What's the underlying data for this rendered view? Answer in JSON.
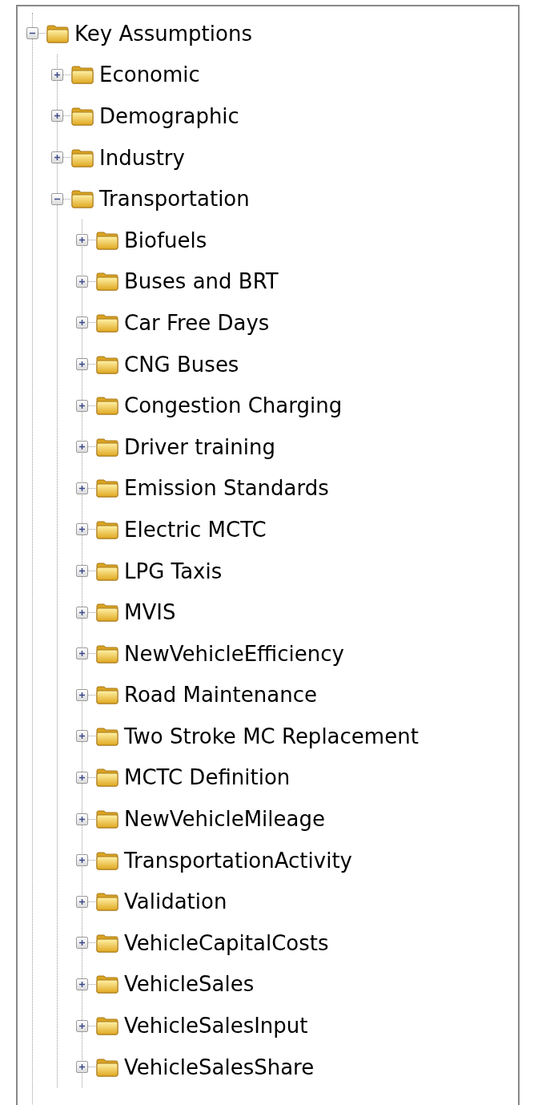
{
  "tree": [
    {
      "label": "Key Assumptions",
      "expanded": true,
      "children": [
        {
          "label": "Economic",
          "expanded": false
        },
        {
          "label": "Demographic",
          "expanded": false
        },
        {
          "label": "Industry",
          "expanded": false
        },
        {
          "label": "Transportation",
          "expanded": true,
          "children": [
            {
              "label": "Biofuels",
              "expanded": false
            },
            {
              "label": "Buses and BRT",
              "expanded": false
            },
            {
              "label": "Car Free Days",
              "expanded": false
            },
            {
              "label": "CNG Buses",
              "expanded": false
            },
            {
              "label": "Congestion Charging",
              "expanded": false
            },
            {
              "label": "Driver training",
              "expanded": false
            },
            {
              "label": "Emission Standards",
              "expanded": false
            },
            {
              "label": "Electric MCTC",
              "expanded": false
            },
            {
              "label": "LPG Taxis",
              "expanded": false
            },
            {
              "label": "MVIS",
              "expanded": false
            },
            {
              "label": "NewVehicleEfficiency",
              "expanded": false
            },
            {
              "label": "Road Maintenance",
              "expanded": false
            },
            {
              "label": "Two Stroke MC Replacement",
              "expanded": false
            },
            {
              "label": "MCTC Definition",
              "expanded": false
            },
            {
              "label": "NewVehicleMileage",
              "expanded": false
            },
            {
              "label": "TransportationActivity",
              "expanded": false
            },
            {
              "label": "Validation",
              "expanded": false
            },
            {
              "label": "VehicleCapitalCosts",
              "expanded": false
            },
            {
              "label": "VehicleSales",
              "expanded": false
            },
            {
              "label": "VehicleSalesInput",
              "expanded": false
            },
            {
              "label": "VehicleSalesShare",
              "expanded": false
            }
          ]
        }
      ]
    }
  ]
}
